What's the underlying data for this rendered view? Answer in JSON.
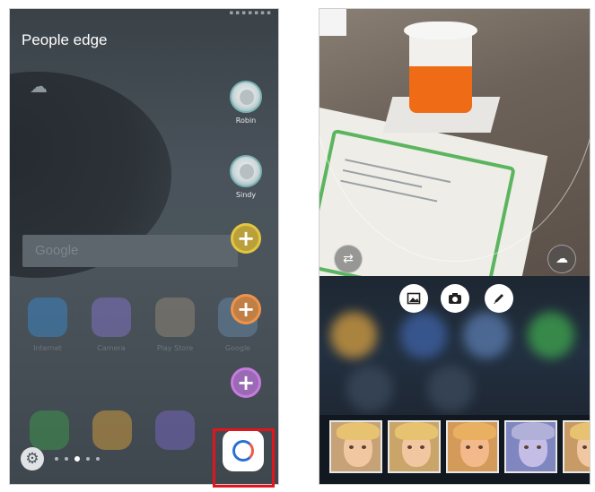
{
  "left_screen": {
    "panel_title": "People edge",
    "contacts": [
      {
        "name": "Robin"
      },
      {
        "name": "Sindy"
      }
    ],
    "google_search_placeholder": "Google",
    "home_apps": [
      "Internet",
      "Camera",
      "Play Store",
      "Google"
    ],
    "add_buttons_count": 3,
    "page_dots": 5,
    "active_page_dot": 3
  },
  "right_screen": {
    "camera_tools": [
      "gallery-icon",
      "camera-icon",
      "pen-icon"
    ],
    "filter_count": 5,
    "filter_labels": [
      "",
      "",
      "",
      "",
      ""
    ]
  },
  "colors": {
    "highlight_box": "#e2151d",
    "add_button_colors": [
      "#d8b93a",
      "#e08a3a",
      "#b06ad0"
    ],
    "edge_ring_blue": "#2b6fd6",
    "edge_ring_red": "#f05b47"
  }
}
